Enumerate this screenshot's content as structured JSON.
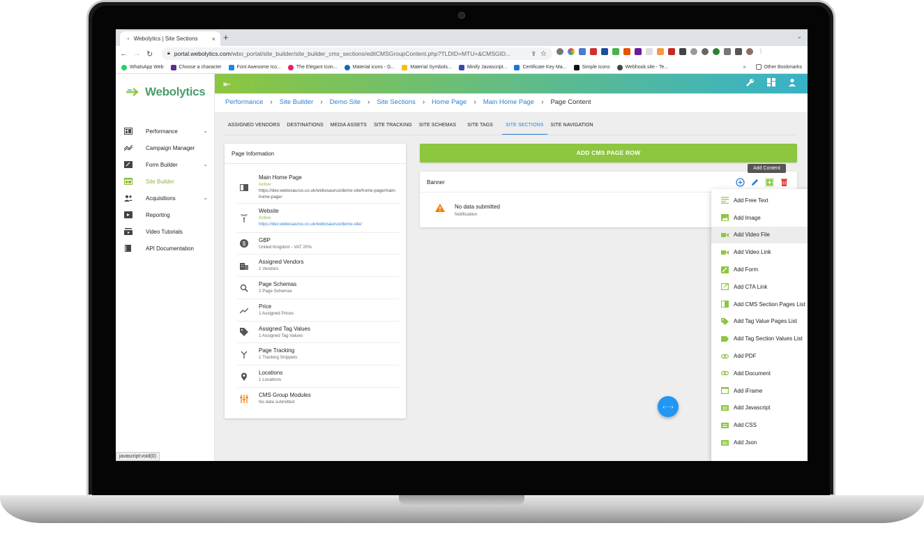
{
  "browser": {
    "tab_title": "Webolytics | Site Sections",
    "url_host": "portal.webolytics.com",
    "url_path": "/wbo_portal/site_builder/site_builder_cms_sections/editCMSGroupContent.php?TLDID=MTU=&CMSGID...",
    "bookmarks": [
      "WhatsApp Web",
      "Choose a character",
      "Font Awesome Ico...",
      "The Elegant Icon...",
      "Material icons - G...",
      "Material Symbols...",
      "Minify Javascript...",
      "Certificate Key Ma...",
      "Simple Icons",
      "Webhook.site - Te..."
    ],
    "bookmarks_overflow": "»",
    "other_bookmarks": "Other Bookmarks",
    "status_url": "javascript:void(0)"
  },
  "brand": {
    "name": "Webolytics",
    "accent": "#8dc63f",
    "teal": "#37b2c9",
    "link": "#2f80d6"
  },
  "sidebar": {
    "items": [
      {
        "label": "Performance",
        "icon": "dashboard-icon",
        "chevron": "⌄"
      },
      {
        "label": "Campaign Manager",
        "icon": "trending-icon",
        "chevron": ""
      },
      {
        "label": "Form Builder",
        "icon": "form-edit-icon",
        "chevron": "⌄"
      },
      {
        "label": "Site Builder",
        "icon": "web-icon",
        "chevron": ""
      },
      {
        "label": "Acquisitions",
        "icon": "people-icon",
        "chevron": "⌄"
      },
      {
        "label": "Reporting",
        "icon": "report-icon",
        "chevron": ""
      },
      {
        "label": "Video Tutorials",
        "icon": "video-library-icon",
        "chevron": ""
      },
      {
        "label": "API Documentation",
        "icon": "book-icon",
        "chevron": ""
      }
    ]
  },
  "breadcrumb": [
    "Performance",
    "Site Builder",
    "Demo Site",
    "Site Sections",
    "Home Page",
    "Main Home Page",
    "Page Content"
  ],
  "tabs": [
    "ASSIGNED VENDORS",
    "DESTINATIONS",
    "MEDIA ASSETS",
    "SITE TRACKING",
    "SITE SCHEMAS",
    "SITE TAGS",
    "SITE SECTIONS",
    "SITE NAVIGATION"
  ],
  "page_info": {
    "title": "Page Information",
    "rows": [
      {
        "name": "Main Home Page",
        "status": "Active",
        "detail": "https://dev.webosaurus.co.uk/webosaurus/demo-site/home-page/main-home-page/"
      },
      {
        "name": "Website",
        "status": "Active",
        "link": "https://dev.webosaurus.co.uk/webosaurus/demo-site/"
      },
      {
        "name": "GBP",
        "sub": "United Kingdom - VAT 20%"
      },
      {
        "name": "Assigned Vendors",
        "sub": "1 Vendors"
      },
      {
        "name": "Page Schemas",
        "sub": "2 Page Schemas"
      },
      {
        "name": "Price",
        "sub": "1 Assigned Prices"
      },
      {
        "name": "Assigned Tag Values",
        "sub": "1 Assigned Tag Values"
      },
      {
        "name": "Page Tracking",
        "sub": "1 Tracking Snippets"
      },
      {
        "name": "Locations",
        "sub": "1 Locations"
      },
      {
        "name": "CMS Group Modules",
        "sub": "No data submitted"
      }
    ]
  },
  "main": {
    "add_row_label": "ADD CMS PAGE ROW",
    "banner_title": "Banner",
    "nodata_title": "No data submitted",
    "nodata_sub": "Notification",
    "tooltip": "Add Content"
  },
  "menu": {
    "items": [
      "Add Free Text",
      "Add Image",
      "Add Video File",
      "Add Video Link",
      "Add Form",
      "Add CTA Link",
      "Add CMS Section Pages List",
      "Add Tag Value Pages List",
      "Add Tag Section Values List",
      "Add PDF",
      "Add Document",
      "Add iFrame",
      "Add Javascript",
      "Add CSS",
      "Add Json"
    ],
    "hovered_index": 2
  },
  "fab_label": "‹···›"
}
